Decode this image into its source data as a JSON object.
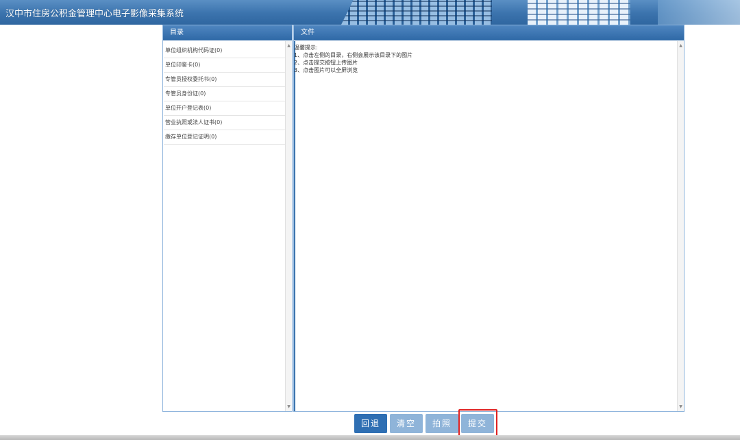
{
  "app": {
    "title": "汉中市住房公积金管理中心电子影像采集系统"
  },
  "directory": {
    "header": "目录",
    "items": [
      "单位组织机构代码证(0)",
      "单位印鉴卡(0)",
      "专管员授权委托书(0)",
      "专管员身份证(0)",
      "单位开户登记表(0)",
      "营业执照或法人证书(0)",
      "缴存单位登记证明(0)"
    ]
  },
  "files": {
    "header": "文件",
    "tips": [
      "温馨提示:",
      "1、点击左侧的目录，右侧会展示该目录下的图片",
      "2、点击提交按钮上传图片",
      "3、点击图片可以全屏浏览"
    ]
  },
  "buttons": {
    "back": "回退",
    "clear": "清空",
    "photo": "拍照",
    "submit": "提交"
  },
  "colors": {
    "header_blue": "#3b73ad",
    "active_button": "#2f6fb3",
    "inactive_button": "#8fb4d9",
    "highlight_red": "#e02020"
  }
}
